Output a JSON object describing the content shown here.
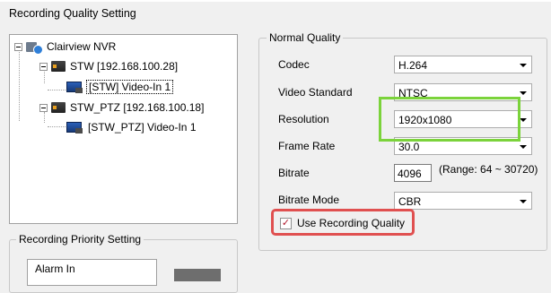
{
  "window": {
    "title": "Recording Quality Setting"
  },
  "tree": {
    "items": [
      {
        "label": "Clairview NVR",
        "icon": "nvr-icon"
      },
      {
        "label": "STW [192.168.100.28]",
        "icon": "dvr-icon"
      },
      {
        "label": "[STW] Video-In 1",
        "icon": "camera-icon",
        "selected": true
      },
      {
        "label": "STW_PTZ [192.168.100.18]",
        "icon": "dvr-icon"
      },
      {
        "label": "[STW_PTZ] Video-In 1",
        "icon": "camera-icon"
      }
    ]
  },
  "priority": {
    "legend": "Recording Priority Setting",
    "alarm_label": "Alarm In"
  },
  "normal_quality": {
    "legend": "Normal Quality",
    "codec": {
      "label": "Codec",
      "value": "H.264"
    },
    "video_standard": {
      "label": "Video Standard",
      "value": "NTSC"
    },
    "resolution": {
      "label": "Resolution",
      "value": "1920x1080"
    },
    "frame_rate": {
      "label": "Frame Rate",
      "value": "30.0"
    },
    "bitrate": {
      "label": "Bitrate",
      "value": "4096",
      "range": "(Range: 64 ~ 30720)"
    },
    "bitrate_mode": {
      "label": "Bitrate Mode",
      "value": "CBR"
    },
    "use_recording_quality": {
      "label": "Use Recording Quality",
      "checked": true,
      "check_glyph": "✓"
    }
  },
  "colors": {
    "highlight_green": "#7bd33b",
    "highlight_red": "#e05050"
  }
}
